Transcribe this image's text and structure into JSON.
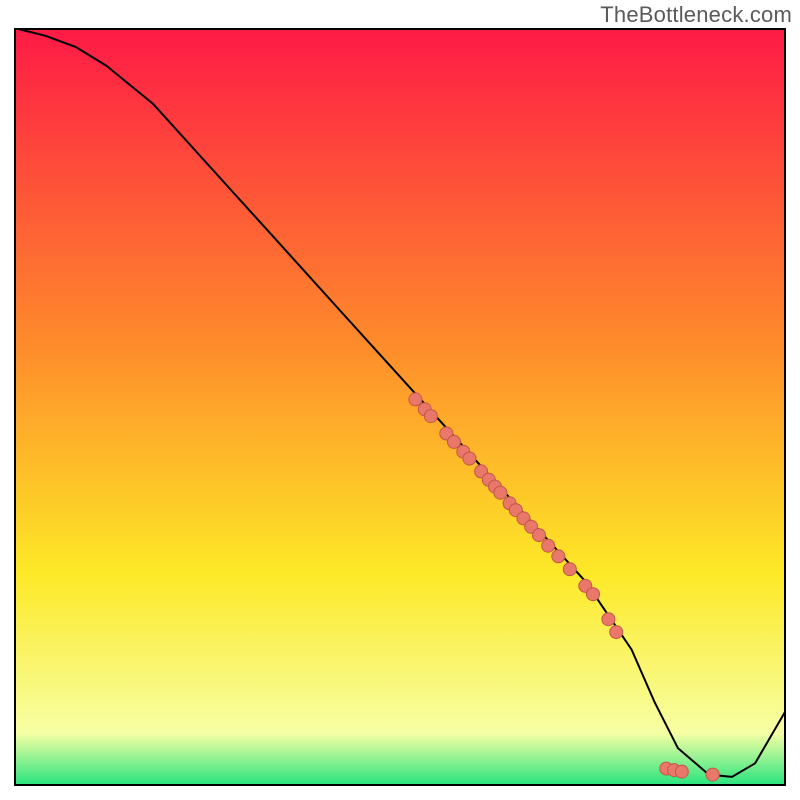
{
  "watermark": "TheBottleneck.com",
  "colors": {
    "frame": "#000000",
    "line": "#000000",
    "point_fill": "#e9786a",
    "point_stroke": "#c25746",
    "gradient_top": "#fe1a46",
    "gradient_mid1": "#fe8c2b",
    "gradient_mid2": "#fde927",
    "gradient_near_bottom": "#f7ffa4",
    "gradient_bottom": "#25e47e"
  },
  "chart_data": {
    "type": "line",
    "title": "",
    "xlabel": "",
    "ylabel": "",
    "xlim": [
      0,
      100
    ],
    "ylim": [
      0,
      100
    ],
    "grid": false,
    "legend": false,
    "background": "vertical spectral gradient red→yellow→green",
    "series": [
      {
        "name": "curve",
        "x": [
          0,
          4,
          8,
          12,
          18,
          26,
          34,
          42,
          50,
          58,
          66,
          74,
          80,
          83,
          86,
          90,
          93,
          96,
          100
        ],
        "y": [
          100,
          99,
          97.5,
          95,
          90,
          81,
          72,
          63,
          54,
          45,
          36,
          27,
          18,
          11,
          5,
          1.5,
          1.2,
          3,
          10
        ]
      }
    ],
    "points": [
      {
        "x": 52.0,
        "y": 51.0
      },
      {
        "x": 53.2,
        "y": 49.7
      },
      {
        "x": 54.0,
        "y": 48.8
      },
      {
        "x": 56.0,
        "y": 46.5
      },
      {
        "x": 57.0,
        "y": 45.4
      },
      {
        "x": 58.2,
        "y": 44.1
      },
      {
        "x": 59.0,
        "y": 43.2
      },
      {
        "x": 60.5,
        "y": 41.5
      },
      {
        "x": 61.5,
        "y": 40.4
      },
      {
        "x": 62.3,
        "y": 39.5
      },
      {
        "x": 63.0,
        "y": 38.7
      },
      {
        "x": 64.2,
        "y": 37.3
      },
      {
        "x": 65.0,
        "y": 36.4
      },
      {
        "x": 66.0,
        "y": 35.3
      },
      {
        "x": 67.0,
        "y": 34.2
      },
      {
        "x": 68.0,
        "y": 33.1
      },
      {
        "x": 69.2,
        "y": 31.7
      },
      {
        "x": 70.5,
        "y": 30.3
      },
      {
        "x": 72.0,
        "y": 28.6
      },
      {
        "x": 74.0,
        "y": 26.4
      },
      {
        "x": 75.0,
        "y": 25.3
      },
      {
        "x": 77.0,
        "y": 22.0
      },
      {
        "x": 78.0,
        "y": 20.3
      },
      {
        "x": 84.5,
        "y": 2.3
      },
      {
        "x": 85.5,
        "y": 2.1
      },
      {
        "x": 86.5,
        "y": 1.9
      },
      {
        "x": 90.5,
        "y": 1.5
      }
    ],
    "point_radius_px": 6.5
  }
}
